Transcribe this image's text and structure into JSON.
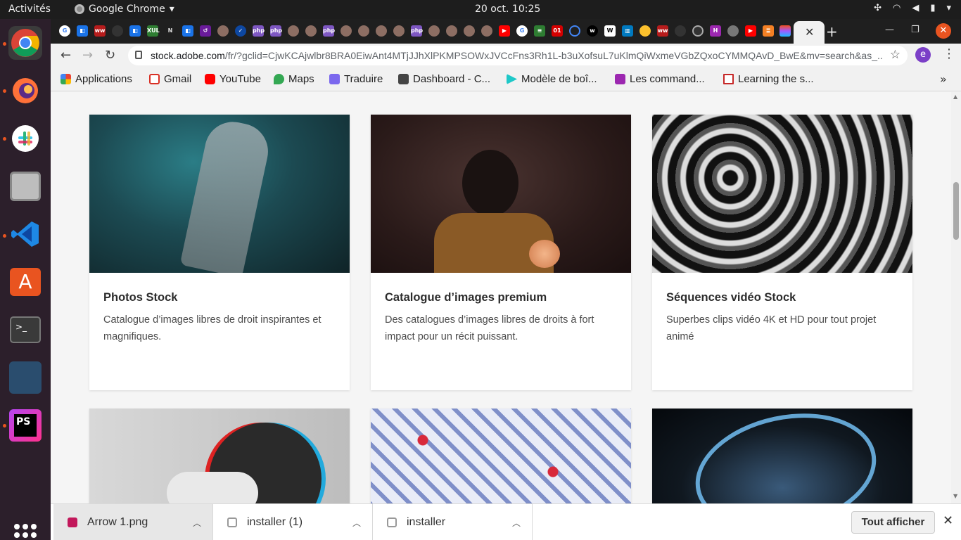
{
  "system": {
    "activities": "Activités",
    "app_name": "Google Chrome",
    "clock": "20 oct.  10:25"
  },
  "browser": {
    "url_host": "stock.adobe.com",
    "url_path": "/fr/?gclid=CjwKCAjwlbr8BRA0EiwAnt4MTjJJhXlPKMPSOWxJVCcFns3Rh1L-b3uXofsuL7uKlmQiWxmeVGbZQxoCYMMQAvD_BwE&mv=search&as_...",
    "profile_initial": "e"
  },
  "bookmarks": [
    {
      "label": "Applications",
      "icon": "apps-grid-icon",
      "color": "#ea4335"
    },
    {
      "label": "Gmail",
      "icon": "gmail-icon",
      "color": "#d93025"
    },
    {
      "label": "YouTube",
      "icon": "youtube-icon",
      "color": "#ff0000"
    },
    {
      "label": "Maps",
      "icon": "maps-icon",
      "color": "#34a853"
    },
    {
      "label": "Traduire",
      "icon": "translate-icon",
      "color": "#7b68ee"
    },
    {
      "label": "Dashboard - C...",
      "icon": "cube-icon",
      "color": "#444444"
    },
    {
      "label": "Modèle de boî...",
      "icon": "play-icon",
      "color": "#1ec8c8"
    },
    {
      "label": "Les command...",
      "icon": "command-icon",
      "color": "#9c27b0"
    },
    {
      "label": "Learning the s...",
      "icon": "doc-icon",
      "color": "#c62828"
    }
  ],
  "cards": [
    {
      "title": "Photos Stock",
      "desc": "Catalogue d’images libres de droit inspirantes et magnifiques."
    },
    {
      "title": "Catalogue d’images premium",
      "desc": "Des catalogues d’images libres de droits à fort impact pour un récit puissant."
    },
    {
      "title": "Séquences vidéo Stock",
      "desc": "Superbes clips vidéo 4K et HD pour tout projet animé"
    }
  ],
  "downloads": [
    {
      "name": "Arrow 1.png"
    },
    {
      "name": "installer (1)"
    },
    {
      "name": "installer"
    }
  ],
  "shelf": {
    "show_all": "Tout afficher"
  },
  "colors": {
    "accent": "#e95420",
    "profile": "#7b3fc7"
  }
}
